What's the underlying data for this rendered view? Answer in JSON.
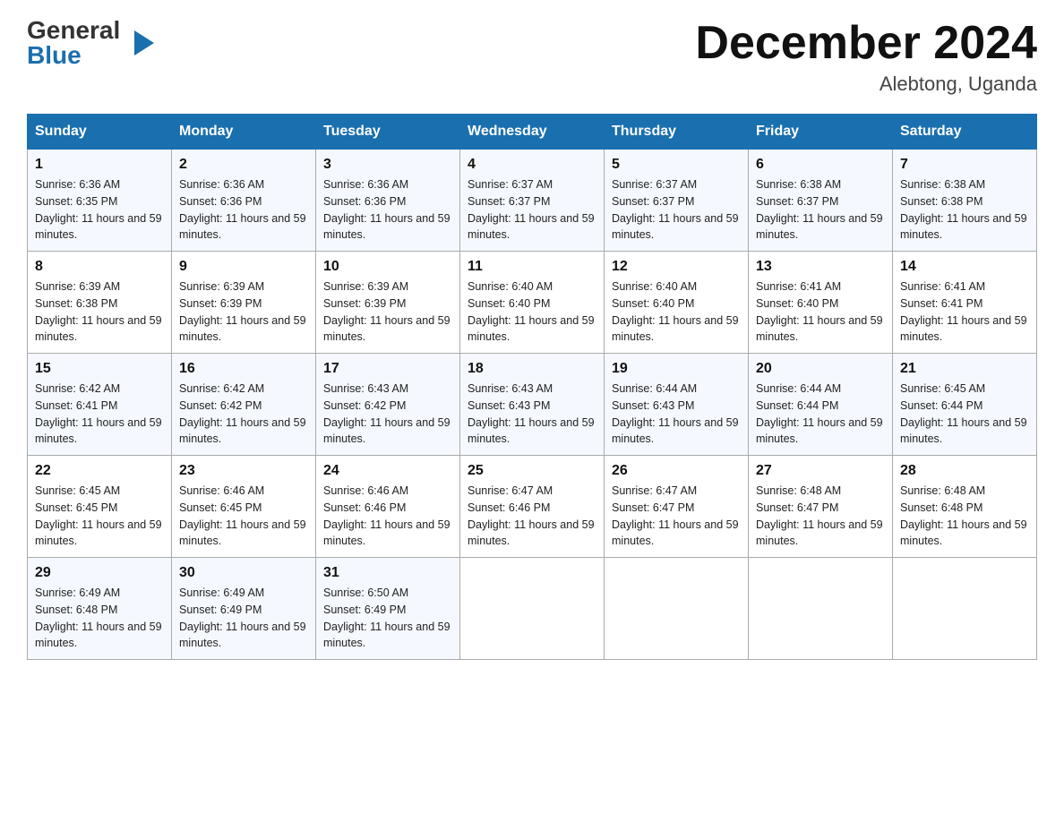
{
  "header": {
    "logo_general": "General",
    "logo_blue": "Blue",
    "month_title": "December 2024",
    "location": "Alebtong, Uganda"
  },
  "days_of_week": [
    "Sunday",
    "Monday",
    "Tuesday",
    "Wednesday",
    "Thursday",
    "Friday",
    "Saturday"
  ],
  "weeks": [
    [
      {
        "day": "1",
        "sunrise": "6:36 AM",
        "sunset": "6:35 PM",
        "daylight": "11 hours and 59 minutes."
      },
      {
        "day": "2",
        "sunrise": "6:36 AM",
        "sunset": "6:36 PM",
        "daylight": "11 hours and 59 minutes."
      },
      {
        "day": "3",
        "sunrise": "6:36 AM",
        "sunset": "6:36 PM",
        "daylight": "11 hours and 59 minutes."
      },
      {
        "day": "4",
        "sunrise": "6:37 AM",
        "sunset": "6:37 PM",
        "daylight": "11 hours and 59 minutes."
      },
      {
        "day": "5",
        "sunrise": "6:37 AM",
        "sunset": "6:37 PM",
        "daylight": "11 hours and 59 minutes."
      },
      {
        "day": "6",
        "sunrise": "6:38 AM",
        "sunset": "6:37 PM",
        "daylight": "11 hours and 59 minutes."
      },
      {
        "day": "7",
        "sunrise": "6:38 AM",
        "sunset": "6:38 PM",
        "daylight": "11 hours and 59 minutes."
      }
    ],
    [
      {
        "day": "8",
        "sunrise": "6:39 AM",
        "sunset": "6:38 PM",
        "daylight": "11 hours and 59 minutes."
      },
      {
        "day": "9",
        "sunrise": "6:39 AM",
        "sunset": "6:39 PM",
        "daylight": "11 hours and 59 minutes."
      },
      {
        "day": "10",
        "sunrise": "6:39 AM",
        "sunset": "6:39 PM",
        "daylight": "11 hours and 59 minutes."
      },
      {
        "day": "11",
        "sunrise": "6:40 AM",
        "sunset": "6:40 PM",
        "daylight": "11 hours and 59 minutes."
      },
      {
        "day": "12",
        "sunrise": "6:40 AM",
        "sunset": "6:40 PM",
        "daylight": "11 hours and 59 minutes."
      },
      {
        "day": "13",
        "sunrise": "6:41 AM",
        "sunset": "6:40 PM",
        "daylight": "11 hours and 59 minutes."
      },
      {
        "day": "14",
        "sunrise": "6:41 AM",
        "sunset": "6:41 PM",
        "daylight": "11 hours and 59 minutes."
      }
    ],
    [
      {
        "day": "15",
        "sunrise": "6:42 AM",
        "sunset": "6:41 PM",
        "daylight": "11 hours and 59 minutes."
      },
      {
        "day": "16",
        "sunrise": "6:42 AM",
        "sunset": "6:42 PM",
        "daylight": "11 hours and 59 minutes."
      },
      {
        "day": "17",
        "sunrise": "6:43 AM",
        "sunset": "6:42 PM",
        "daylight": "11 hours and 59 minutes."
      },
      {
        "day": "18",
        "sunrise": "6:43 AM",
        "sunset": "6:43 PM",
        "daylight": "11 hours and 59 minutes."
      },
      {
        "day": "19",
        "sunrise": "6:44 AM",
        "sunset": "6:43 PM",
        "daylight": "11 hours and 59 minutes."
      },
      {
        "day": "20",
        "sunrise": "6:44 AM",
        "sunset": "6:44 PM",
        "daylight": "11 hours and 59 minutes."
      },
      {
        "day": "21",
        "sunrise": "6:45 AM",
        "sunset": "6:44 PM",
        "daylight": "11 hours and 59 minutes."
      }
    ],
    [
      {
        "day": "22",
        "sunrise": "6:45 AM",
        "sunset": "6:45 PM",
        "daylight": "11 hours and 59 minutes."
      },
      {
        "day": "23",
        "sunrise": "6:46 AM",
        "sunset": "6:45 PM",
        "daylight": "11 hours and 59 minutes."
      },
      {
        "day": "24",
        "sunrise": "6:46 AM",
        "sunset": "6:46 PM",
        "daylight": "11 hours and 59 minutes."
      },
      {
        "day": "25",
        "sunrise": "6:47 AM",
        "sunset": "6:46 PM",
        "daylight": "11 hours and 59 minutes."
      },
      {
        "day": "26",
        "sunrise": "6:47 AM",
        "sunset": "6:47 PM",
        "daylight": "11 hours and 59 minutes."
      },
      {
        "day": "27",
        "sunrise": "6:48 AM",
        "sunset": "6:47 PM",
        "daylight": "11 hours and 59 minutes."
      },
      {
        "day": "28",
        "sunrise": "6:48 AM",
        "sunset": "6:48 PM",
        "daylight": "11 hours and 59 minutes."
      }
    ],
    [
      {
        "day": "29",
        "sunrise": "6:49 AM",
        "sunset": "6:48 PM",
        "daylight": "11 hours and 59 minutes."
      },
      {
        "day": "30",
        "sunrise": "6:49 AM",
        "sunset": "6:49 PM",
        "daylight": "11 hours and 59 minutes."
      },
      {
        "day": "31",
        "sunrise": "6:50 AM",
        "sunset": "6:49 PM",
        "daylight": "11 hours and 59 minutes."
      },
      null,
      null,
      null,
      null
    ]
  ]
}
